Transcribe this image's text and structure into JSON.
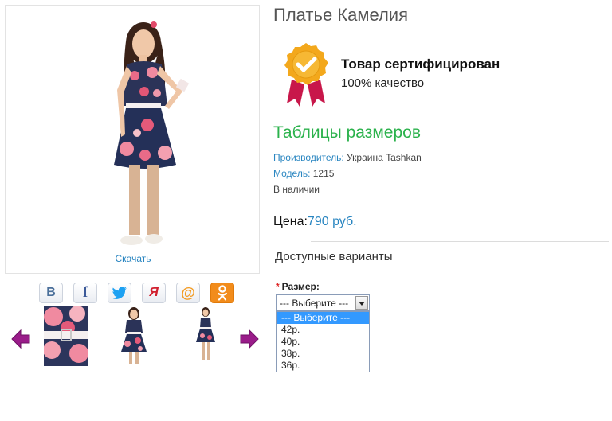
{
  "product": {
    "title": "Платье Камелия",
    "download_label": "Скачать"
  },
  "certificate": {
    "title": "Товар сертифицирован",
    "subtitle": "100% качество",
    "badge_color": "#f3a81c",
    "ribbon_color": "#c8174a"
  },
  "sizes_table_link": "Таблицы размеров",
  "details": {
    "manufacturer_label": "Производитель:",
    "manufacturer_value": " Украина Tashkan",
    "model_label": "Модель:",
    "model_value": " 1215",
    "availability": "В наличии"
  },
  "price": {
    "label": "Цена:",
    "value": "790 руб."
  },
  "variants": {
    "heading": "Доступные варианты",
    "size_label": "Размер:",
    "required_mark": "*",
    "selected": "--- Выберите ---",
    "options": [
      "--- Выберите ---",
      "42р.",
      "40р.",
      "38р.",
      "36р."
    ]
  },
  "social": [
    {
      "icon": "vk-icon",
      "glyph": "B",
      "color": "#4a6f9a"
    },
    {
      "icon": "facebook-icon",
      "glyph": "f",
      "color": "#3b5998"
    },
    {
      "icon": "twitter-icon",
      "glyph": "",
      "color": "#1da1f2"
    },
    {
      "icon": "moimir-icon",
      "glyph": "Я",
      "color": "#d1202f"
    },
    {
      "icon": "mail-icon",
      "glyph": "@",
      "color": "#f39a1e"
    },
    {
      "icon": "odnoklassniki-icon",
      "glyph": "",
      "color": "#ffffff"
    }
  ],
  "colors": {
    "link": "#2a86c1",
    "green": "#2bb24c",
    "arrow": "#9a1c8a"
  }
}
